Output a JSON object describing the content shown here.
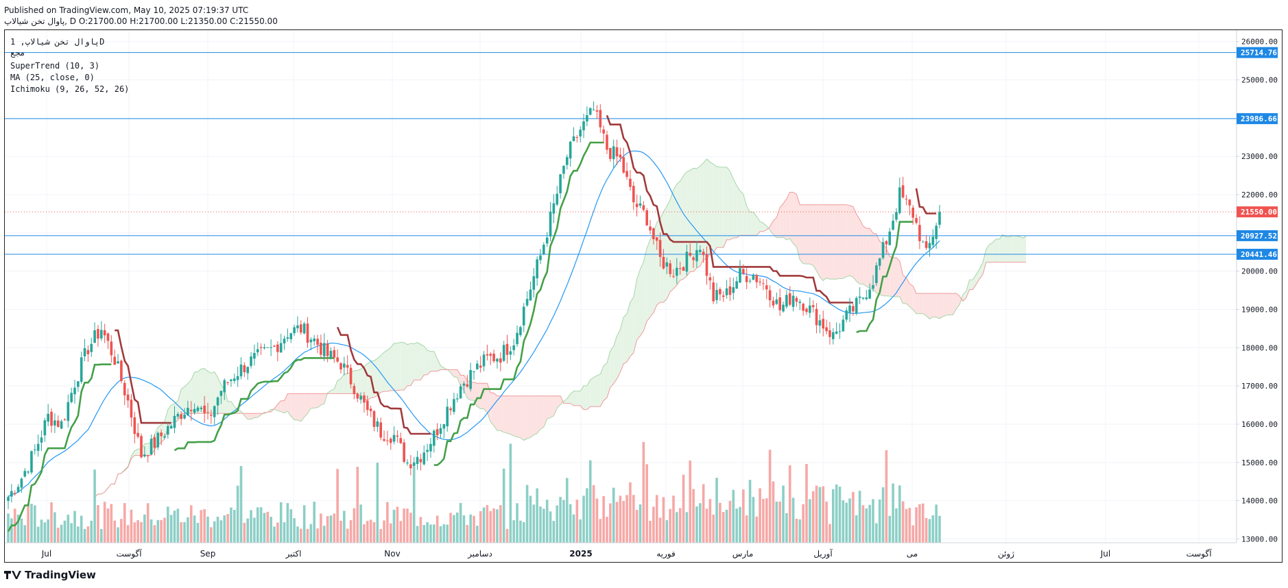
{
  "header": {
    "published": "Published on TradingView.com, May 10, 2025 07:19:37 UTC",
    "ohlc_line": "پاوال تخن شیالاپ, D O:21700.00 H:21700.00 L:21350.00 C:21550.00"
  },
  "legend": {
    "symbol": "پاوال تخن شیالاپ, 1D",
    "sub": "مجع",
    "supertrend": "SuperTrend (10, 3)",
    "ma": "MA (25, close, 0)",
    "ichimoku": "Ichimoku (9, 26, 52, 26)"
  },
  "footer": {
    "brand": "TradingView"
  },
  "colors": {
    "up": "#26a69a",
    "down": "#ef5350",
    "st_up": "#43a047",
    "st_down": "#a1393b",
    "ma": "#2196f3",
    "h_line": "#1e88e5",
    "cloud_green": "#e6f4e6",
    "cloud_red": "#fde2e2"
  },
  "chart_data": {
    "type": "candlestick",
    "ylim": [
      12900,
      26300
    ],
    "y_ticks": [
      "26000.00",
      "25000.00",
      "24000.00",
      "23000.00",
      "22000.00",
      "21000.00",
      "20000.00",
      "19000.00",
      "18000.00",
      "17000.00",
      "16000.00",
      "15000.00",
      "14000.00",
      "13000.00"
    ],
    "x_ticks": [
      "Jul",
      "آگوست",
      "Sep",
      "اکتبر",
      "Nov",
      "دسامبر",
      "2025",
      "فوریه",
      "مارس",
      "آوریل",
      "می",
      "ژوئن",
      "Jul",
      "آگوست"
    ],
    "horizontal_levels": [
      {
        "value": 25714.76,
        "label": "25714.76"
      },
      {
        "value": 23986.66,
        "label": "23986.66"
      },
      {
        "value": 20927.52,
        "label": "20927.52"
      },
      {
        "value": 20441.46,
        "label": "20441.46"
      }
    ],
    "last_price": {
      "value": 21550.0,
      "label": "21550.00"
    },
    "last_bar": {
      "open": 21700.0,
      "high": 21700.0,
      "low": 21350.0,
      "close": 21550.0
    },
    "price_path": [
      [
        0,
        14100
      ],
      [
        4,
        14600
      ],
      [
        8,
        15300
      ],
      [
        12,
        16200
      ],
      [
        16,
        16000
      ],
      [
        20,
        17100
      ],
      [
        24,
        18000
      ],
      [
        28,
        18500
      ],
      [
        32,
        17700
      ],
      [
        36,
        16600
      ],
      [
        40,
        15200
      ],
      [
        44,
        15500
      ],
      [
        48,
        15900
      ],
      [
        52,
        16300
      ],
      [
        56,
        16600
      ],
      [
        60,
        16100
      ],
      [
        64,
        16900
      ],
      [
        68,
        17300
      ],
      [
        72,
        17600
      ],
      [
        76,
        17800
      ],
      [
        80,
        18000
      ],
      [
        84,
        18400
      ],
      [
        88,
        18500
      ],
      [
        92,
        18200
      ],
      [
        96,
        17800
      ],
      [
        100,
        17600
      ],
      [
        104,
        17000
      ],
      [
        108,
        16300
      ],
      [
        112,
        15800
      ],
      [
        116,
        15700
      ],
      [
        120,
        15000
      ],
      [
        124,
        15200
      ],
      [
        128,
        15700
      ],
      [
        132,
        16400
      ],
      [
        136,
        17000
      ],
      [
        140,
        17400
      ],
      [
        144,
        17700
      ],
      [
        148,
        17800
      ],
      [
        152,
        18200
      ],
      [
        156,
        19300
      ],
      [
        160,
        20400
      ],
      [
        164,
        21700
      ],
      [
        168,
        23000
      ],
      [
        172,
        23700
      ],
      [
        176,
        24200
      ],
      [
        180,
        23200
      ],
      [
        184,
        22900
      ],
      [
        188,
        21800
      ],
      [
        192,
        21400
      ],
      [
        196,
        20300
      ],
      [
        200,
        20000
      ],
      [
        204,
        20300
      ],
      [
        208,
        20700
      ],
      [
        212,
        19300
      ],
      [
        216,
        19400
      ],
      [
        220,
        19900
      ],
      [
        224,
        19900
      ],
      [
        228,
        19600
      ],
      [
        232,
        19000
      ],
      [
        236,
        19400
      ],
      [
        240,
        19100
      ],
      [
        244,
        18700
      ],
      [
        248,
        18300
      ],
      [
        252,
        18800
      ],
      [
        256,
        19200
      ],
      [
        260,
        19800
      ],
      [
        264,
        20800
      ],
      [
        268,
        22000
      ],
      [
        272,
        21500
      ],
      [
        276,
        20400
      ],
      [
        280,
        21550
      ]
    ],
    "volume_series": "daily volume bars colored by candle direction"
  }
}
